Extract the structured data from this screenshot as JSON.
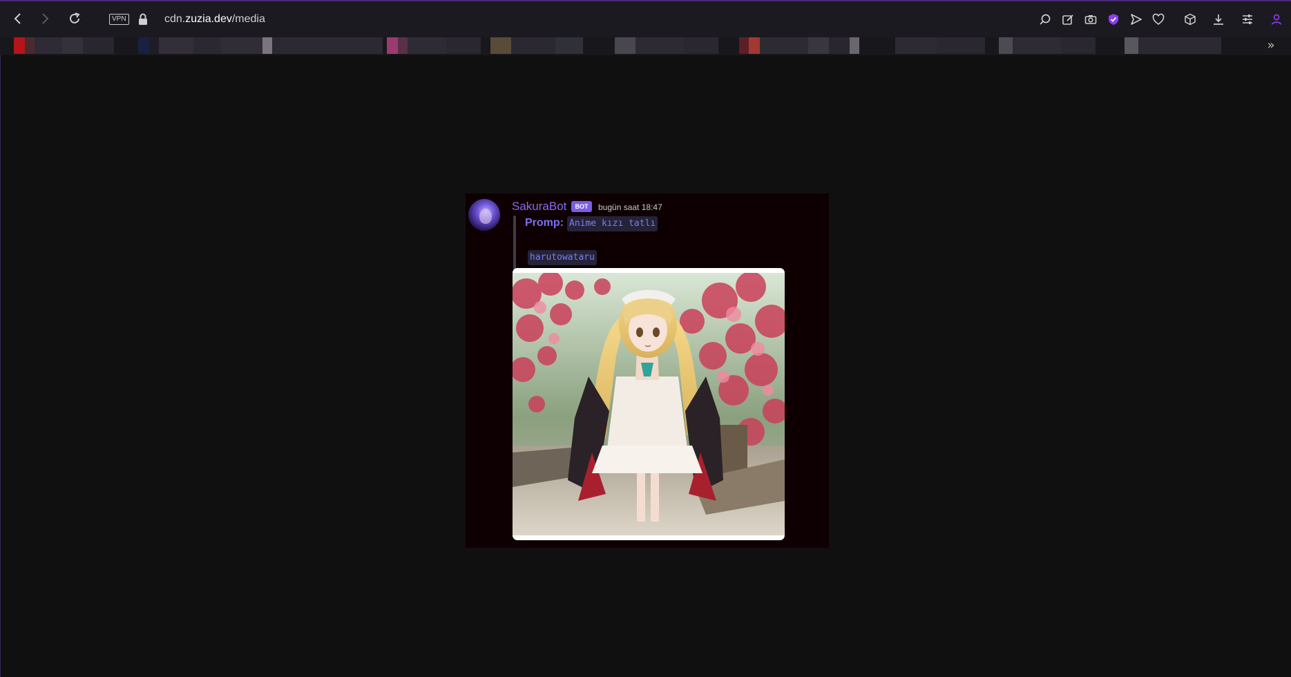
{
  "browser": {
    "vpn_label": "VPN",
    "url_prefix": "cdn.",
    "url_domain": "zuzia.dev",
    "url_path": "/media",
    "accent_color": "#8a3cf0"
  },
  "toolbar_icons": [
    "search-icon",
    "edit-icon",
    "camera-icon",
    "shield-icon",
    "send-icon",
    "heart-icon",
    "box-icon",
    "download-icon",
    "settings-icon",
    "profile-icon"
  ],
  "bookmarks": {
    "overflow_label": "»"
  },
  "message": {
    "username": "SakuraBot",
    "bot_tag": "BOT",
    "timestamp": "bugün saat 18:47",
    "prompt_label": "Promp:",
    "prompt_text": "Anime kızı tatlı",
    "author_text": "harutowataru",
    "name_color": "#8a6cf0",
    "code_color": "#7d7ef0"
  }
}
